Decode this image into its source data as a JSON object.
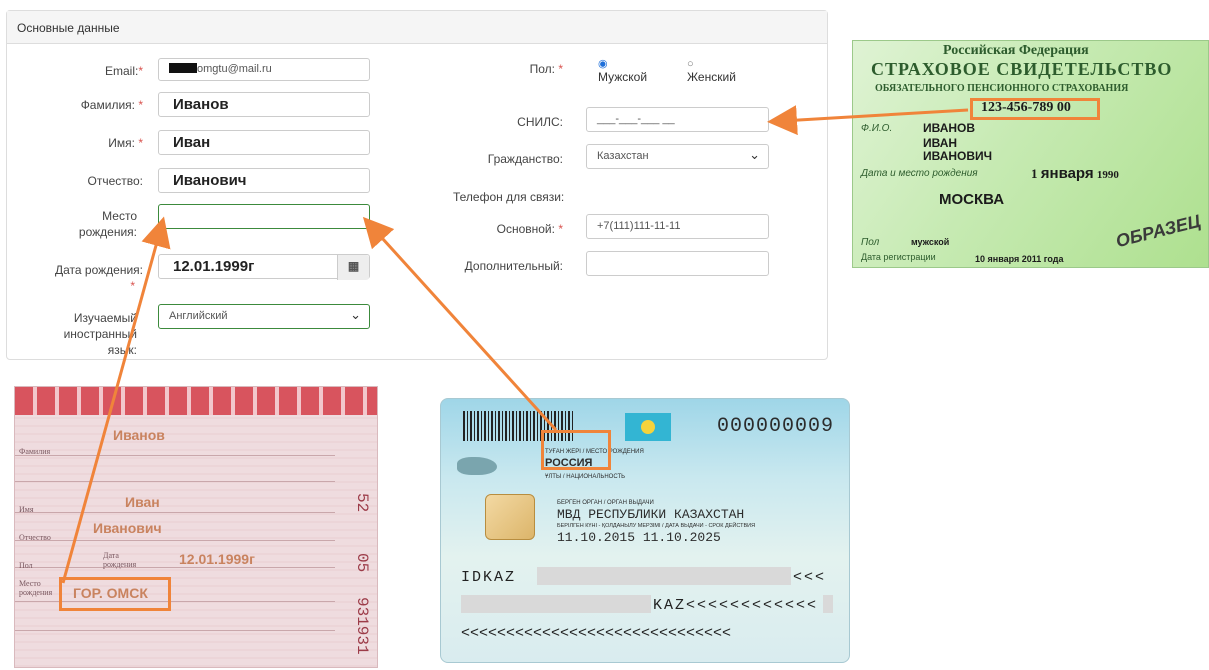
{
  "panel": {
    "title": "Основные данные"
  },
  "form": {
    "email_label": "Email:",
    "email_value": "omgtu@mail.ru",
    "lastname_label": "Фамилия:",
    "lastname_value": "Иванов",
    "firstname_label": "Имя:",
    "firstname_value": "Иван",
    "patronymic_label": "Отчество:",
    "patronymic_value": "Иванович",
    "birthplace_label_1": "Место",
    "birthplace_label_2": "рождения:",
    "birthdate_label": "Дата рождения:",
    "birthdate_value": "12.01.1999г",
    "language_label_1": "Изучаемый",
    "language_label_2": "иностранный",
    "language_label_3": "язык:",
    "language_value": "Английский",
    "gender_label": "Пол:",
    "gender_male": "Мужской",
    "gender_female": "Женский",
    "snils_label": "СНИЛС:",
    "snils_placeholder": "___-___-___ __",
    "citizenship_label": "Гражданство:",
    "citizenship_value": "Казахстан",
    "phone_section": "Телефон для связи:",
    "phone_main_label": "Основной:",
    "phone_main_value": "+7(111)111-11-11",
    "phone_extra_label": "Дополнительный:",
    "required_mark": "*",
    "calendar_icon": "calendar-icon"
  },
  "snils_card": {
    "country": "Российская Федерация",
    "title": "СТРАХОВОЕ СВИДЕТЕЛЬСТВО",
    "subtitle": "ОБЯЗАТЕЛЬНОГО ПЕНСИОННОГО СТРАХОВАНИЯ",
    "number": "123-456-789 00",
    "fio_label": "Ф.И.О.",
    "fio_1": "ИВАНОВ",
    "fio_2": "ИВАН",
    "fio_3": "ИВАНОВИЧ",
    "birth_label": "Дата и место рождения",
    "birth_date_num": "1",
    "birth_date_month": "января",
    "birth_date_year": "1990",
    "birth_place": "МОСКВА",
    "sex_label": "Пол",
    "sex_value": "мужской",
    "reg_label": "Дата регистрации",
    "reg_value": "10 января 2011 года",
    "stamp": "ОБРАЗЕЦ"
  },
  "passport_page": {
    "lastname": "Иванов",
    "lastname_label": "Фамилия",
    "firstname": "Иван",
    "firstname_label": "Имя",
    "patronymic": "Иванович",
    "patronymic_label": "Отчество",
    "sex_label": "Пол",
    "birthdate_label_1": "Дата",
    "birthdate_label_2": "рождения",
    "birthdate": "12.01.1999г",
    "birthplace_label_1": "Место",
    "birthplace_label_2": "рождения",
    "birthplace": "ГОР. ОМСК",
    "num_1": "52",
    "num_2": "05",
    "num_3": "931931"
  },
  "id_card": {
    "number": "000000009",
    "birthplace_label": "ТУҒАН ЖЕРІ / МЕСТО РОЖДЕНИЯ",
    "birthplace": "РОССИЯ",
    "nationality_label": "ҰЛТЫ / НАЦИОНАЛЬНОСТЬ",
    "issuer_label": "БЕРГЕН ОРГАН / ОРГАН ВЫДАЧИ",
    "issuer": "МВД РЕСПУБЛИКИ КАЗАХСТАН",
    "dates_label": "БЕРІЛГЕН КҮНІ - ҚОЛДАНЫЛУ МЕРЗІМІ / ДАТА ВЫДАЧИ - СРОК ДЕЙСТВИЯ",
    "dates": "11.10.2015  11.10.2025",
    "mrz_1a": "IDKAZ",
    "mrz_1b": "<<<",
    "mrz_2": "KAZ<<<<<<<<<<<<",
    "mrz_3": "<<<<<<<<<<<<<<<<<<<<<<<<<<<<<<"
  },
  "colors": {
    "accent": "#f0843a",
    "required": "#d9534f",
    "focus": "#3c8a3c"
  }
}
